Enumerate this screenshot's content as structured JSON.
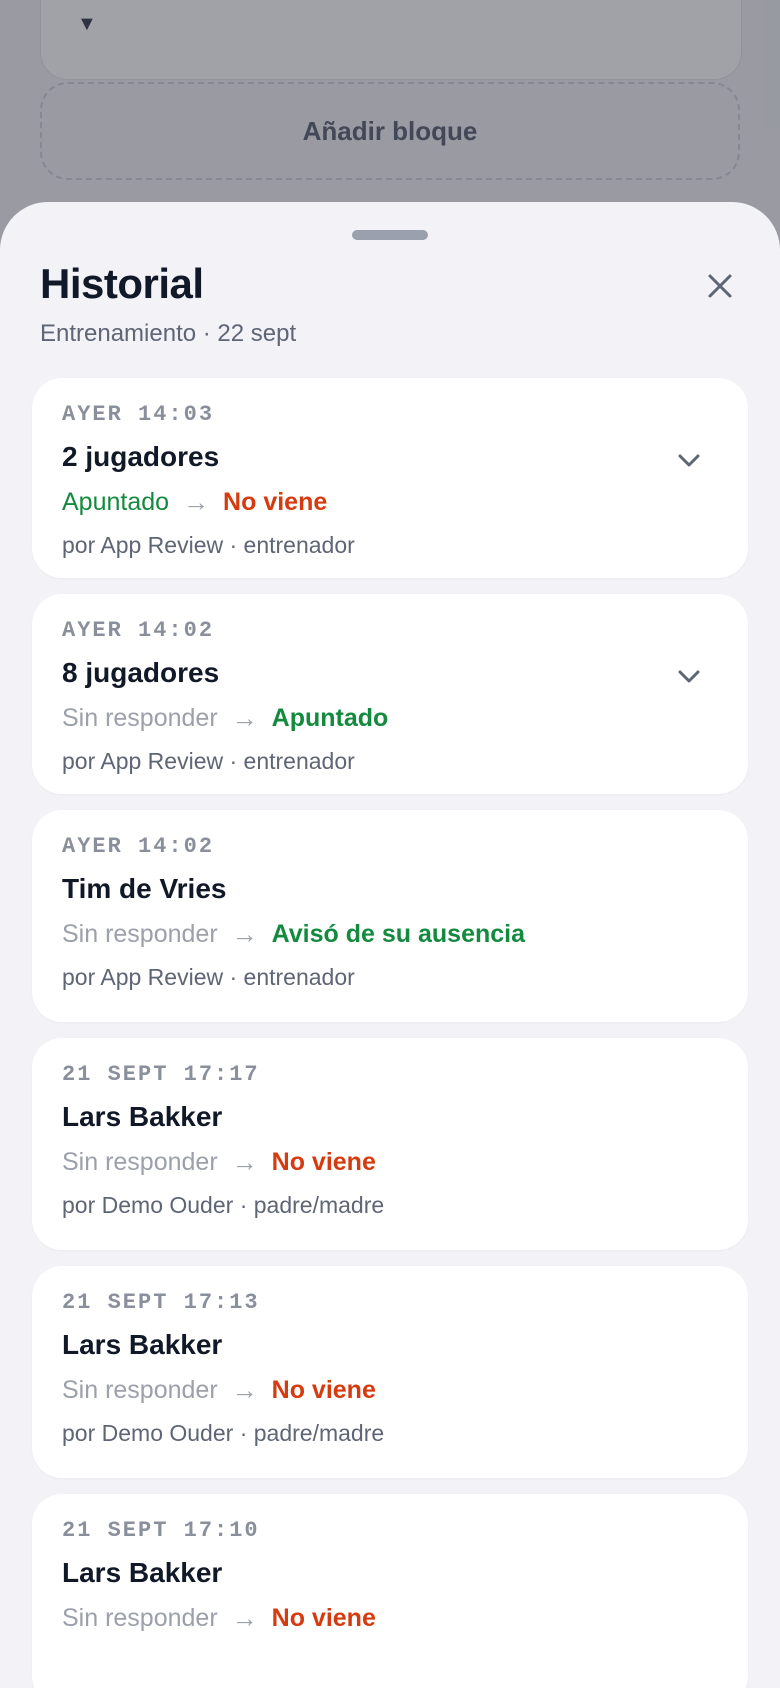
{
  "background": {
    "add_block_label": "Añadir bloque",
    "caret": "▼"
  },
  "sheet": {
    "title": "Historial",
    "subtitle": "Entrenamiento · 22 sept"
  },
  "entries": [
    {
      "time": "AYER 14:03",
      "name": "2 jugadores",
      "from": "Apuntado",
      "to": "No viene",
      "by": "por App Review · entrenador"
    },
    {
      "time": "AYER 14:02",
      "name": "8 jugadores",
      "from": "Sin responder",
      "to": "Apuntado",
      "by": "por App Review · entrenador"
    },
    {
      "time": "AYER 14:02",
      "name": "Tim de Vries",
      "from": "Sin responder",
      "to": "Avisó de su ausencia",
      "by": "por App Review · entrenador"
    },
    {
      "time": "21 SEPT 17:17",
      "name": "Lars Bakker",
      "from": "Sin responder",
      "to": "No viene",
      "by": "por Demo Ouder · padre/madre"
    },
    {
      "time": "21 SEPT 17:13",
      "name": "Lars Bakker",
      "from": "Sin responder",
      "to": "No viene",
      "by": "por Demo Ouder · padre/madre"
    },
    {
      "time": "21 SEPT 17:10",
      "name": "Lars Bakker",
      "from": "Sin responder",
      "to": "No viene",
      "by": ""
    }
  ],
  "arrow": "→",
  "colors": {
    "red": "#d63b10",
    "green": "#138a3e",
    "muted": "#9ba0ab"
  }
}
